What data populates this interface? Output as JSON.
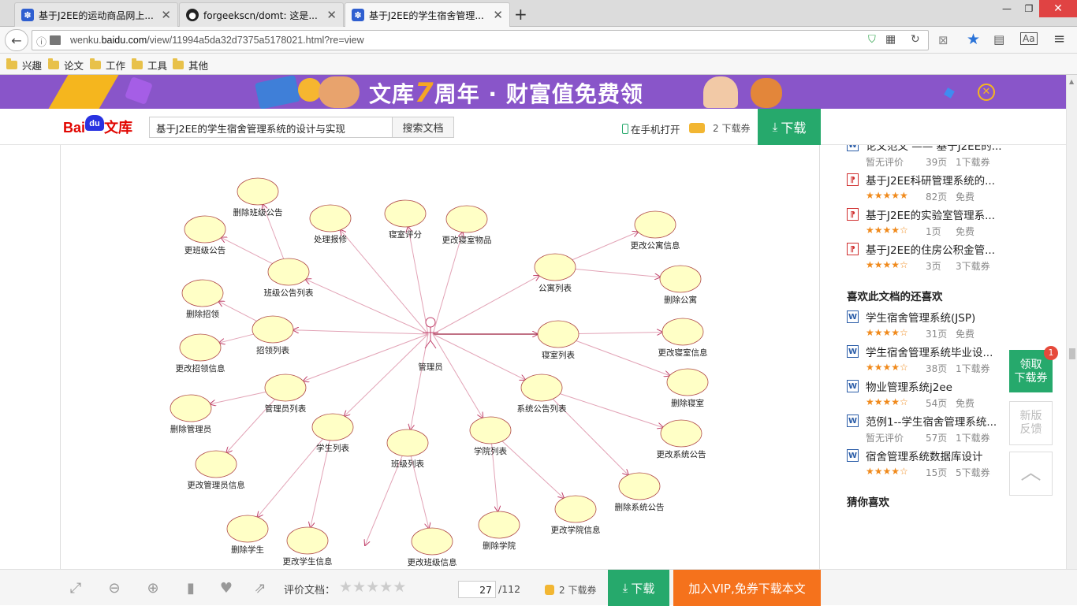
{
  "browser": {
    "tabs": [
      {
        "title": "基于J2EE的运动商品网上...",
        "active": false
      },
      {
        "title": "forgeekscn/domt: 这是...",
        "active": false
      },
      {
        "title": "基于J2EE的学生宿舍管理...",
        "active": true
      }
    ],
    "url_prefix": "wenku.",
    "url_domain": "baidu.com",
    "url_path": "/view/11994a5da32d7375a5178021.html?re=view",
    "bookmarks": [
      "兴趣",
      "论文",
      "工作",
      "工具",
      "其他"
    ]
  },
  "banner": {
    "text_a": "文库",
    "text_seven": "7",
    "text_b": "周年 · 财富值免费领"
  },
  "header": {
    "logo_text": "文库",
    "search_value": "基于J2EE的学生宿舍管理系统的设计与实现",
    "search_button": "搜索文档",
    "open_on_phone": "在手机打开",
    "coupon_count": "2 下载券",
    "download": "下载"
  },
  "diagram": {
    "actor": "管理员",
    "use_cases": [
      {
        "id": "uc1",
        "label": "删除班级公告"
      },
      {
        "id": "uc2",
        "label": "更班级公告"
      },
      {
        "id": "uc3",
        "label": "处理报修"
      },
      {
        "id": "uc4",
        "label": "寝室评分"
      },
      {
        "id": "uc5",
        "label": "更改寝室物品"
      },
      {
        "id": "uc6",
        "label": "班级公告列表"
      },
      {
        "id": "uc7",
        "label": "删除招领"
      },
      {
        "id": "uc8",
        "label": "招领列表"
      },
      {
        "id": "uc9",
        "label": "更改招领信息"
      },
      {
        "id": "uc10",
        "label": "管理员列表"
      },
      {
        "id": "uc11",
        "label": "删除管理员"
      },
      {
        "id": "uc12",
        "label": "更改管理员信息"
      },
      {
        "id": "uc13",
        "label": "学生列表"
      },
      {
        "id": "uc14",
        "label": "删除学生"
      },
      {
        "id": "uc15",
        "label": "更改学生信息"
      },
      {
        "id": "uc16",
        "label": "班级列表"
      },
      {
        "id": "uc17",
        "label": "更改班级信息"
      },
      {
        "id": "uc18",
        "label": "学院列表"
      },
      {
        "id": "uc19",
        "label": "删除学院"
      },
      {
        "id": "uc20",
        "label": "更改学院信息"
      },
      {
        "id": "uc21",
        "label": "公寓列表"
      },
      {
        "id": "uc22",
        "label": "更改公寓信息"
      },
      {
        "id": "uc23",
        "label": "删除公寓"
      },
      {
        "id": "uc24",
        "label": "寝室列表"
      },
      {
        "id": "uc25",
        "label": "更改寝室信息"
      },
      {
        "id": "uc26",
        "label": "删除寝室"
      },
      {
        "id": "uc27",
        "label": "系统公告列表"
      },
      {
        "id": "uc28",
        "label": "更改系统公告"
      },
      {
        "id": "uc29",
        "label": "删除系统公告"
      }
    ]
  },
  "sidebar": {
    "top_partial": {
      "title": "论文范文 —— 基于J2EE的...",
      "rating": "暂无评价",
      "pages": "39页",
      "cost": "1下载券"
    },
    "related": [
      {
        "type": "pdf",
        "title": "基于J2EE科研管理系统的...",
        "stars": "★★★★★",
        "pages": "82页",
        "cost": "免费"
      },
      {
        "type": "pdf",
        "title": "基于J2EE的实验室管理系...",
        "stars": "★★★★☆",
        "pages": "1页",
        "cost": "免费"
      },
      {
        "type": "pdf",
        "title": "基于J2EE的住房公积金管...",
        "stars": "★★★★☆",
        "pages": "3页",
        "cost": "3下载券"
      }
    ],
    "also_like_title": "喜欢此文档的还喜欢",
    "also_like": [
      {
        "type": "doc",
        "title": "学生宿舍管理系统(JSP)",
        "stars": "★★★★☆",
        "pages": "31页",
        "cost": "免费"
      },
      {
        "type": "doc",
        "title": "学生宿舍管理系统毕业设...",
        "stars": "★★★★☆",
        "pages": "38页",
        "cost": "1下载券"
      },
      {
        "type": "doc",
        "title": "物业管理系统j2ee",
        "stars": "★★★★☆",
        "pages": "54页",
        "cost": "免费"
      },
      {
        "type": "doc",
        "title": "范例1--学生宿舍管理系统...",
        "stars": "暂无评价",
        "pages": "57页",
        "cost": "1下载券"
      },
      {
        "type": "doc",
        "title": "宿舍管理系统数据库设计",
        "stars": "★★★★☆",
        "pages": "15页",
        "cost": "5下载券"
      }
    ],
    "guess_title": "猜你喜欢"
  },
  "floating": {
    "get_coupon_1": "领取",
    "get_coupon_2": "下载券",
    "badge": "1",
    "feedback_1": "新版",
    "feedback_2": "反馈"
  },
  "bottombar": {
    "rate_label": "评价文档：",
    "current_page": "27",
    "total_pages": "/112",
    "coupon": "2 下载券",
    "download": "下载",
    "vip": "加入VIP,免券下载本文"
  },
  "colors": {
    "green": "#26a96c",
    "orange": "#f5721c",
    "banner": "#8955c9",
    "ellipse_fill": "#ffffc6",
    "arrow": "#c0406a"
  }
}
